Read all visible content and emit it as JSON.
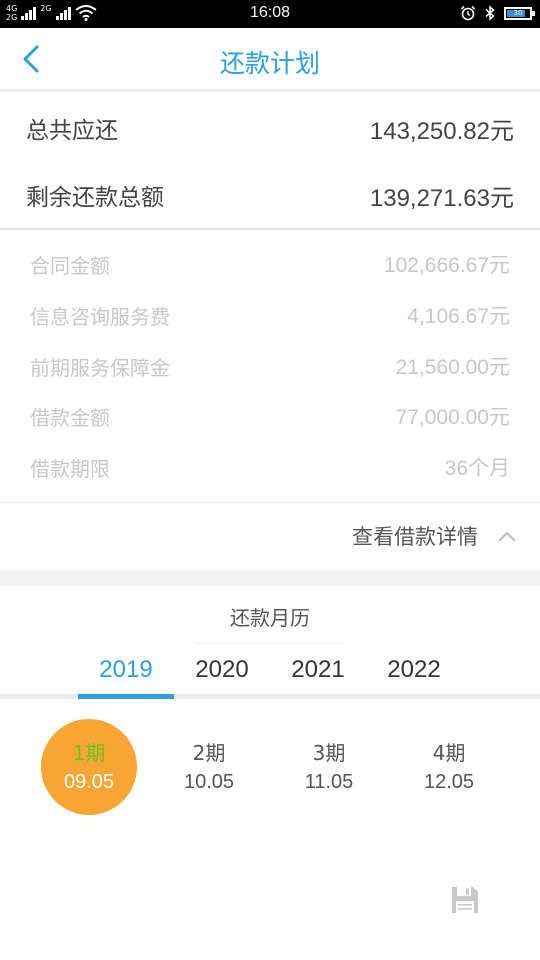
{
  "status_bar": {
    "network_top": "4G",
    "network_bottom": "2G",
    "network_2": "2G",
    "time": "16:08",
    "battery_text": "30"
  },
  "header": {
    "title": "还款计划",
    "back_icon": "chevron-left-icon"
  },
  "totals": {
    "total_due_label": "总共应还",
    "total_due_value": "143,250.82元",
    "remaining_label": "剩余还款总额",
    "remaining_value": "139,271.63元"
  },
  "details": [
    {
      "label": "合同金额",
      "value": "102,666.67元"
    },
    {
      "label": "信息咨询服务费",
      "value": "4,106.67元"
    },
    {
      "label": "前期服务保障金",
      "value": "21,560.00元"
    },
    {
      "label": "借款金额",
      "value": "77,000.00元"
    },
    {
      "label": "借款期限",
      "value": "36个月"
    }
  ],
  "toggle": {
    "label": "查看借款详情",
    "icon": "chevron-up-icon"
  },
  "calendar": {
    "title": "还款月历",
    "years": [
      "2019",
      "2020",
      "2021",
      "2022"
    ],
    "selected_year": "2019",
    "periods": [
      {
        "name": "1期",
        "date": "09.05",
        "active": true
      },
      {
        "name": "2期",
        "date": "10.05",
        "active": false
      },
      {
        "name": "3期",
        "date": "11.05",
        "active": false
      },
      {
        "name": "4期",
        "date": "12.05",
        "active": false
      }
    ]
  },
  "colors": {
    "accent": "#2aa0de",
    "active_period_bg": "#f7a633",
    "active_period_label": "#6fbf2a",
    "muted_text": "#c8c8c8"
  },
  "fab_icon": "floppy-save-icon"
}
